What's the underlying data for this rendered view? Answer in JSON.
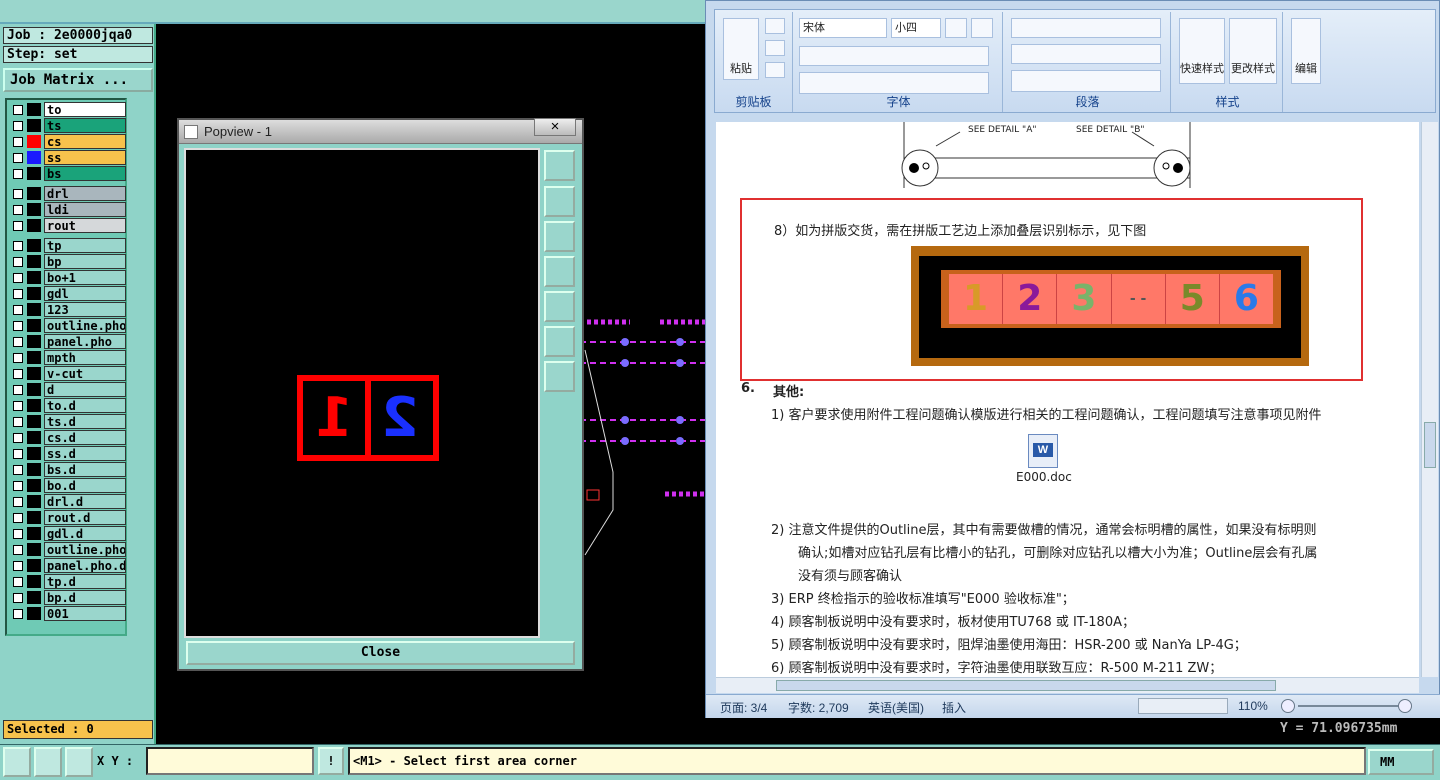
{
  "genesis": {
    "job_label": "Job : 2e0000jqa0",
    "step_label": "Step: set",
    "matrix_button": "Job Matrix ...",
    "layers": [
      {
        "name": "to",
        "color": "#ffffff",
        "swatch": "#000000"
      },
      {
        "name": "ts",
        "color": "#1aa37a",
        "swatch": "#000000"
      },
      {
        "name": "cs",
        "color": "#f7c24c",
        "swatch": "#ff0000"
      },
      {
        "name": "ss",
        "color": "#f7c24c",
        "swatch": "#1a1aff"
      },
      {
        "name": "bs",
        "color": "#1aa37a",
        "swatch": "#000000"
      },
      {
        "name": "drl",
        "color": "#a9b6bd",
        "swatch": "#000000"
      },
      {
        "name": "ldi",
        "color": "#a9b6bd",
        "swatch": "#000000"
      },
      {
        "name": "rout",
        "color": "#d5d8da",
        "swatch": "#000000"
      },
      {
        "name": "tp",
        "color": "#9ad6cc",
        "swatch": "#000000"
      },
      {
        "name": "bp",
        "color": "#9ad6cc",
        "swatch": "#000000"
      },
      {
        "name": "bo+1",
        "color": "#9ad6cc",
        "swatch": "#000000"
      },
      {
        "name": "gdl",
        "color": "#9ad6cc",
        "swatch": "#000000"
      },
      {
        "name": "123",
        "color": "#9ad6cc",
        "swatch": "#000000"
      },
      {
        "name": "outline.pho",
        "color": "#9ad6cc",
        "swatch": "#000000"
      },
      {
        "name": "panel.pho",
        "color": "#9ad6cc",
        "swatch": "#000000"
      },
      {
        "name": "mpth",
        "color": "#9ad6cc",
        "swatch": "#000000"
      },
      {
        "name": "v-cut",
        "color": "#9ad6cc",
        "swatch": "#000000"
      },
      {
        "name": "d",
        "color": "#9ad6cc",
        "swatch": "#000000"
      },
      {
        "name": "to.d",
        "color": "#9ad6cc",
        "swatch": "#000000"
      },
      {
        "name": "ts.d",
        "color": "#9ad6cc",
        "swatch": "#000000"
      },
      {
        "name": "cs.d",
        "color": "#9ad6cc",
        "swatch": "#000000"
      },
      {
        "name": "ss.d",
        "color": "#9ad6cc",
        "swatch": "#000000"
      },
      {
        "name": "bs.d",
        "color": "#9ad6cc",
        "swatch": "#000000"
      },
      {
        "name": "bo.d",
        "color": "#9ad6cc",
        "swatch": "#000000"
      },
      {
        "name": "drl.d",
        "color": "#9ad6cc",
        "swatch": "#000000"
      },
      {
        "name": "rout.d",
        "color": "#9ad6cc",
        "swatch": "#000000"
      },
      {
        "name": "gdl.d",
        "color": "#9ad6cc",
        "swatch": "#000000"
      },
      {
        "name": "outline.pho",
        "color": "#9ad6cc",
        "swatch": "#000000"
      },
      {
        "name": "panel.pho.d",
        "color": "#9ad6cc",
        "swatch": "#000000"
      },
      {
        "name": "tp.d",
        "color": "#9ad6cc",
        "swatch": "#000000"
      },
      {
        "name": "bp.d",
        "color": "#9ad6cc",
        "swatch": "#000000"
      },
      {
        "name": "001",
        "color": "#9ad6cc",
        "swatch": "#000000"
      }
    ],
    "selected": "Selected : 0",
    "xy_label": "X Y :",
    "xy_value": "",
    "bang": "!",
    "status_message": "<M1> - Select first area corner",
    "units": "MM",
    "coordinate": "Y = 71.096735mm"
  },
  "popview": {
    "title": "Popview - 1",
    "close_x": "×",
    "close_button": "Close",
    "num1": "1",
    "num2": "2"
  },
  "word": {
    "clipboard": {
      "paste": "粘贴",
      "label": "剪贴板"
    },
    "font": {
      "name": "宋体",
      "size": "小四",
      "label": "字体"
    },
    "paragraph_label": "段落",
    "styles": {
      "quick": "快速样式",
      "change": "更改样式",
      "label": "样式"
    },
    "edit": "编辑",
    "detail_a": "SEE DETAIL \"A\"",
    "detail_b": "SEE DETAIL \"B\"",
    "item8": "8）如为拼版交货，需在拼版工艺边上添加叠层识别标示，见下图",
    "layer_digits": [
      "1",
      "2",
      "3",
      "5",
      "6"
    ],
    "layer_dots": "- -",
    "section_num": "6.",
    "section_title": "其他:",
    "lines": [
      "1)  客户要求使用附件工程问题确认模版进行相关的工程问题确认，工程问题填写注意事项见附件",
      "2)  注意文件提供的Outline层，其中有需要做槽的情况，通常会标明槽的属性，如果没有标明则",
      "确认;如槽对应钻孔层有比槽小的钻孔，可删除对应钻孔以槽大小为准；Outline层会有孔属",
      "没有须与顾客确认",
      "3)  ERP 终检指示的验收标准填写\"E000 验收标准\"；",
      "4)  顾客制板说明中没有要求时，板材使用TU768 或 IT-180A；",
      "5)  顾客制板说明中没有要求时，阻焊油墨使用海田：HSR-200 或 NanYa   LP-4G；",
      "6)  顾客制板说明中没有要求时，字符油墨使用联致互应：R-500  M-211  ZW；"
    ],
    "attachment": "E000.doc",
    "status": {
      "page": "页面: 3/4",
      "words": "字数: 2,709",
      "lang": "英语(美国)",
      "mode": "插入",
      "zoom": "110%"
    }
  }
}
